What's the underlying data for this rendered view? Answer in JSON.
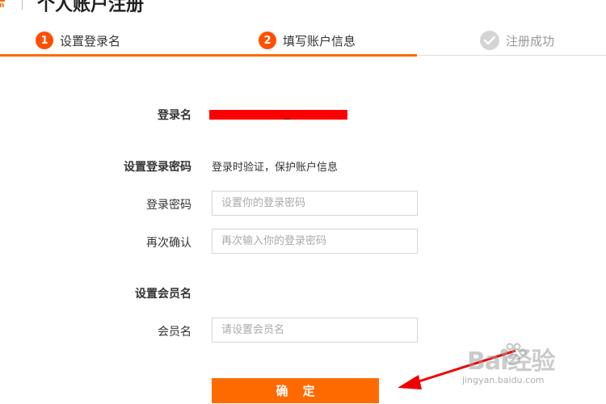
{
  "header": {
    "brand_label": "m",
    "title": "个人账户注册"
  },
  "steps": [
    {
      "number": "1",
      "label": "设置登录名",
      "state": "complete"
    },
    {
      "number": "2",
      "label": "填写账户信息",
      "state": "active"
    },
    {
      "number": "",
      "label": "注册成功",
      "state": "pending"
    }
  ],
  "colors": {
    "accent": "#ff6a00",
    "step_badge": "#ff4f00",
    "redaction": "#ff0000",
    "pending_badge": "#d4d4d4"
  },
  "form": {
    "login_name_label": "登录名",
    "login_name_value": "_",
    "password_section_label": "设置登录密码",
    "password_section_note": "登录时验证，保护账户信息",
    "password_label": "登录密码",
    "password_placeholder": "设置你的登录密码",
    "confirm_label": "再次确认",
    "confirm_placeholder": "再次输入你的登录密码",
    "member_section_label": "设置会员名",
    "member_label": "会员名",
    "member_placeholder": "请设置会员名",
    "submit_label": "确定"
  },
  "watermark": {
    "logo": "Bai经验",
    "url": "jingyan.baidu.com"
  },
  "icons": {
    "step_done": "check-icon",
    "annotation": "red-arrow-icon"
  }
}
